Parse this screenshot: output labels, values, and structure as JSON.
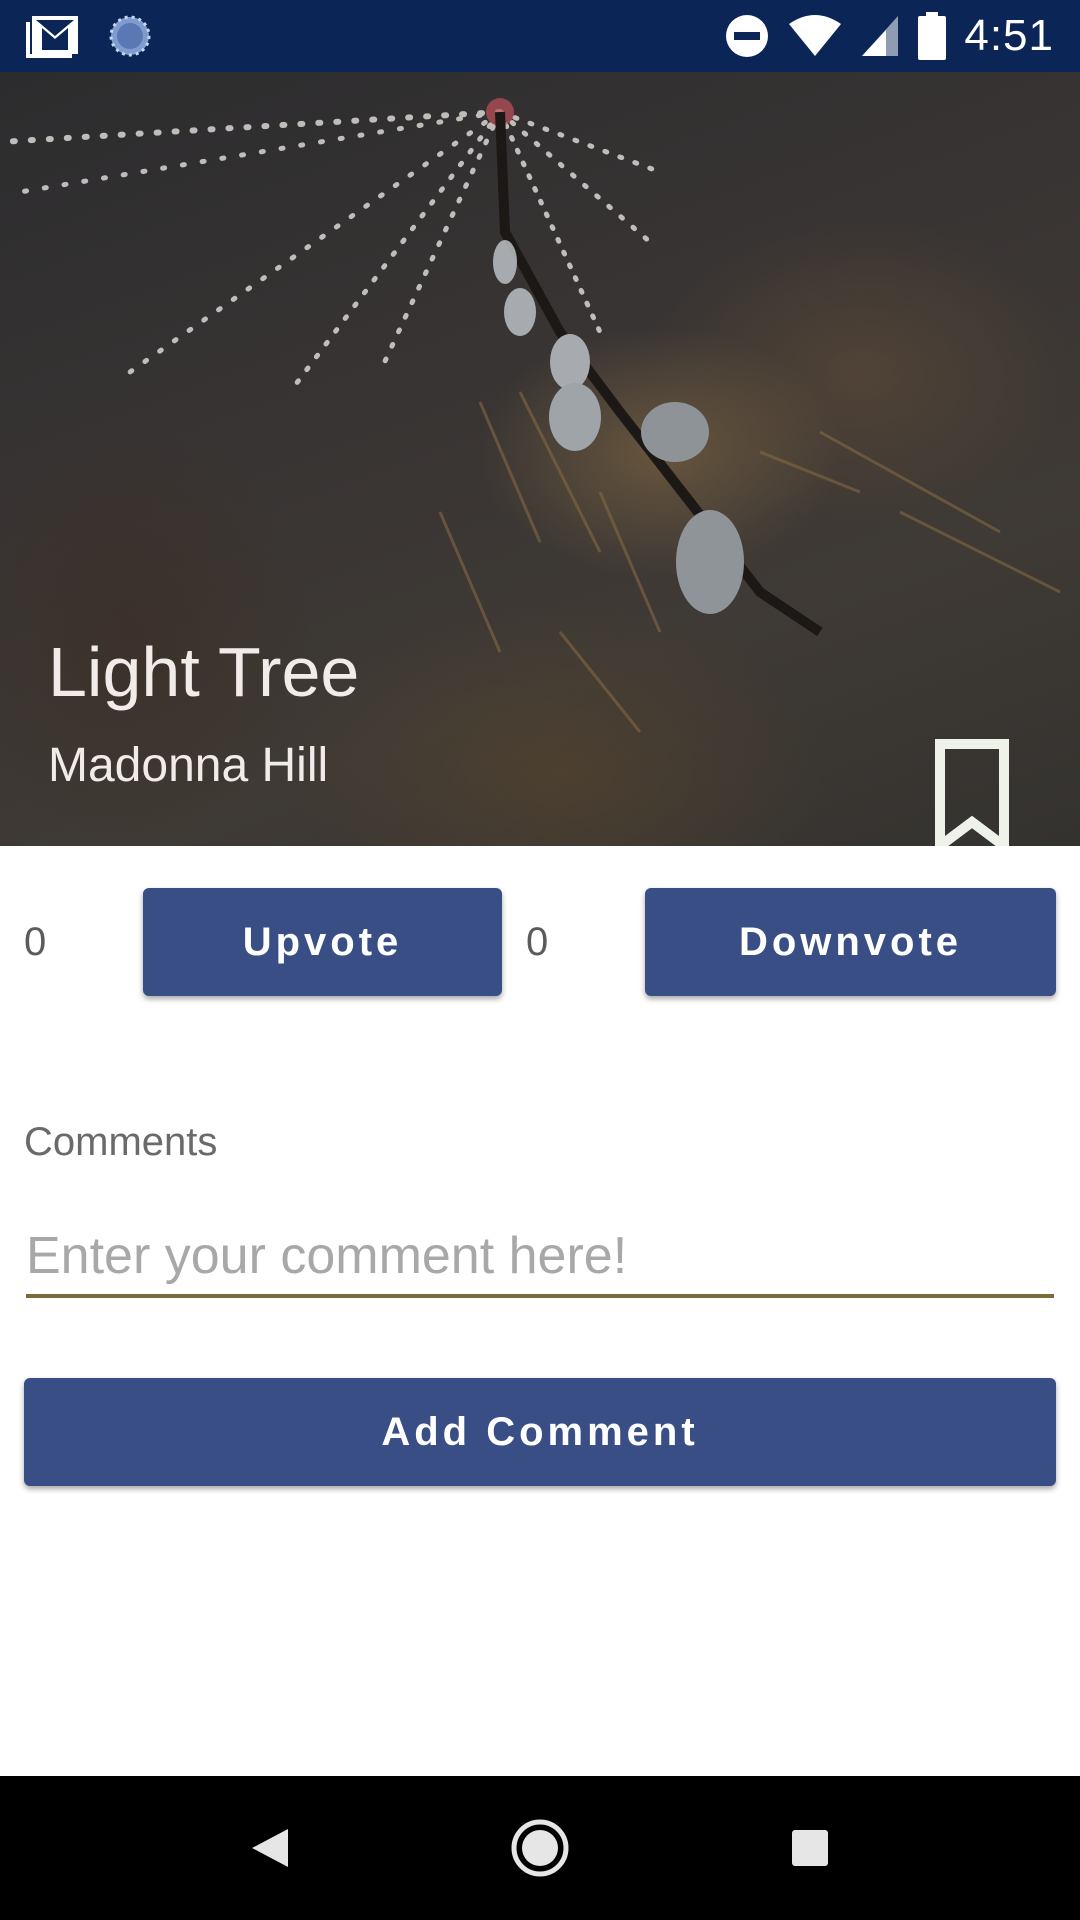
{
  "status_bar": {
    "time": "4:51",
    "icons": [
      "gmail-icon",
      "sync-icon",
      "do-not-disturb-icon",
      "wifi-icon",
      "cell-signal-icon",
      "battery-icon"
    ]
  },
  "place": {
    "title": "Light Tree",
    "subtitle": "Madonna Hill",
    "bookmark_icon": "bookmark-outline-icon"
  },
  "votes": {
    "upvote_count": "0",
    "upvote_label": "Upvote",
    "downvote_count": "0",
    "downvote_label": "Downvote"
  },
  "comments": {
    "label": "Comments",
    "input_value": "",
    "input_placeholder": "Enter your comment here!",
    "add_label": "Add Comment"
  },
  "nav": {
    "icons": [
      "back-icon",
      "home-icon",
      "recents-icon"
    ]
  },
  "colors": {
    "status_bar": "#0b2556",
    "button": "#3a4e86",
    "input_underline": "#7b6a3a",
    "nav_bar": "#000000"
  }
}
